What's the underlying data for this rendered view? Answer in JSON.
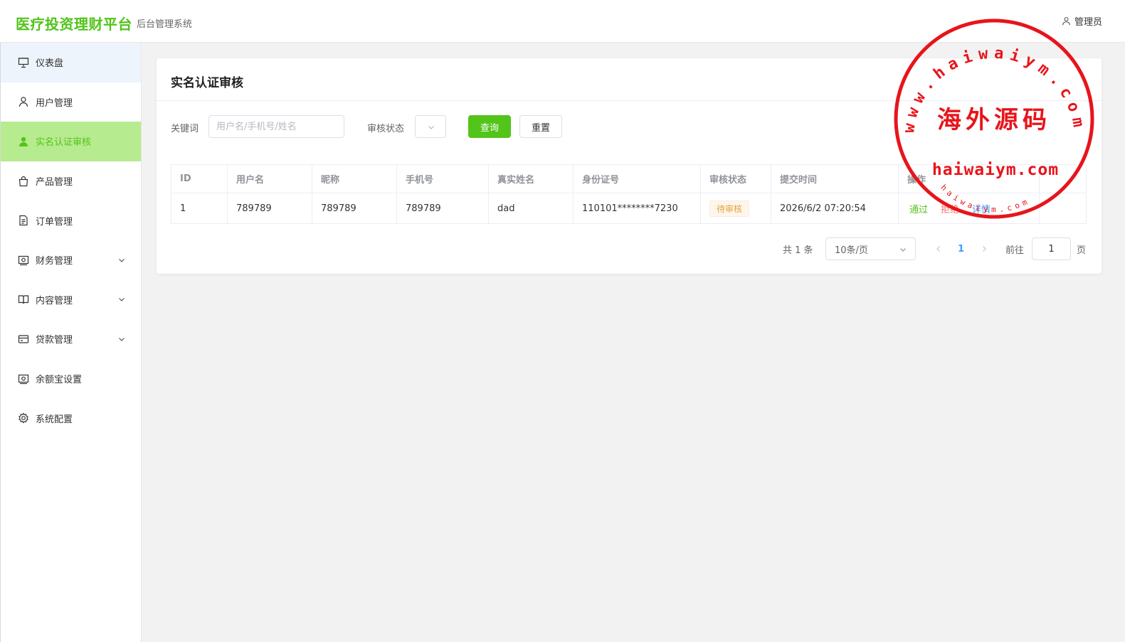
{
  "header": {
    "brand": "医疗投资理财平台",
    "subtitle": "后台管理系统",
    "user_label": "管理员"
  },
  "sidebar": {
    "items": [
      {
        "label": "仪表盘",
        "icon": "dashboard-icon"
      },
      {
        "label": "用户管理",
        "icon": "user-icon"
      },
      {
        "label": "实名认证审核",
        "icon": "user-solid-icon"
      },
      {
        "label": "产品管理",
        "icon": "bag-icon"
      },
      {
        "label": "订单管理",
        "icon": "document-icon"
      },
      {
        "label": "财务管理",
        "icon": "money-icon"
      },
      {
        "label": "内容管理",
        "icon": "book-icon"
      },
      {
        "label": "贷款管理",
        "icon": "card-icon"
      },
      {
        "label": "余额宝设置",
        "icon": "money-icon"
      },
      {
        "label": "系统配置",
        "icon": "gear-icon"
      }
    ],
    "active_index": 2
  },
  "page": {
    "title": "实名认证审核",
    "filters": {
      "keyword_label": "关键词",
      "keyword_placeholder": "用户名/手机号/姓名",
      "keyword_value": "",
      "status_label": "审核状态",
      "status_value": "",
      "search_label": "查询",
      "reset_label": "重置"
    },
    "table": {
      "columns": [
        "ID",
        "用户名",
        "昵称",
        "手机号",
        "真实姓名",
        "身份证号",
        "审核状态",
        "提交时间",
        "操作"
      ],
      "rows": [
        {
          "id": "1",
          "username": "789789",
          "nickname": "789789",
          "phone": "789789",
          "realname": "dad",
          "idcard": "110101********7230",
          "status": "待审核",
          "time": "2026/6/2 07:20:54",
          "actions": {
            "approve": "通过",
            "reject": "拒绝",
            "detail": "详情"
          }
        }
      ]
    },
    "pagination": {
      "total": "共 1 条",
      "page_size": "10条/页",
      "current": "1",
      "goto_label": "前往",
      "goto_value": "1",
      "page_suffix": "页"
    }
  },
  "watermark": {
    "url_arc": "www.haiwaiym.com",
    "center": "海外源码",
    "lower": "haiwaiym.com",
    "small_arc": "haiwaiym.com",
    "color": "#e8141b"
  },
  "colors": {
    "primary": "#52c41a",
    "active_bg": "#b7eb8f",
    "danger": "#f56c6c",
    "info": "#409eff",
    "warning": "#e6a23c"
  }
}
